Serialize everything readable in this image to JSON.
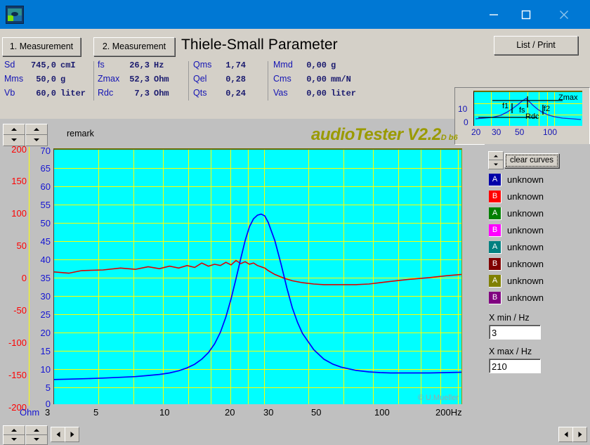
{
  "window": {
    "app_icon": "audiotester-app-icon",
    "minimize": "minimize-icon",
    "maximize": "maximize-icon",
    "close": "close-icon"
  },
  "toolbar": {
    "tab1_label": "1. Measurement",
    "tab2_label": "2. Measurement",
    "panel_title": "Thiele-Small Parameter",
    "list_print_label": "List / Print"
  },
  "parameters": {
    "group1": [
      {
        "name": "Sd",
        "value": "745,0",
        "unit": "cmI"
      },
      {
        "name": "Mms",
        "value": "50,0",
        "unit": "g"
      },
      {
        "name": "Vb",
        "value": "60,0",
        "unit": "liter"
      }
    ],
    "group2": [
      {
        "name": "fs",
        "value": "26,3",
        "unit": "Hz"
      },
      {
        "name": "Zmax",
        "value": "52,3",
        "unit": "Ohm"
      },
      {
        "name": "Rdc",
        "value": "7,3",
        "unit": "Ohm"
      }
    ],
    "group3": [
      {
        "name": "Qms",
        "value": "1,74",
        "unit": ""
      },
      {
        "name": "Qel",
        "value": "0,28",
        "unit": ""
      },
      {
        "name": "Qts",
        "value": "0,24",
        "unit": ""
      }
    ],
    "group4": [
      {
        "name": "Mmd",
        "value": "0,00",
        "unit": "g"
      },
      {
        "name": "Cms",
        "value": "0,00",
        "unit": "mm/N"
      },
      {
        "name": "Vas",
        "value": "0,00",
        "unit": "liter"
      }
    ]
  },
  "mini_chart": {
    "y_labels": [
      "10",
      "0"
    ],
    "x_labels": [
      "20",
      "30",
      "50",
      "100"
    ],
    "annotations": [
      "Zmax",
      "f1",
      "fs",
      "f2",
      "Rdc"
    ]
  },
  "remark": {
    "label": "remark",
    "spinner_left": "remark-spinner-left",
    "spinner_right": "remark-spinner-right"
  },
  "logo": {
    "text": "audioTester V2.2",
    "suffix": "D b6"
  },
  "chart_data": {
    "type": "line",
    "title": "",
    "xlabel": "Hz",
    "ylabel": "Ohm",
    "xscale": "log",
    "xlim": [
      3,
      210
    ],
    "x_ticks": [
      "3",
      "5",
      "10",
      "20",
      "30",
      "50",
      "100",
      "200Hz"
    ],
    "x_tick_values": [
      3,
      5,
      10,
      20,
      30,
      50,
      100,
      200
    ],
    "grid": true,
    "left_axis_phase": {
      "label": "",
      "color": "#ff0000",
      "ylim": [
        -200,
        200
      ],
      "ticks": [
        "200",
        "150",
        "100",
        "50",
        "0",
        "-50",
        "-100",
        "-150",
        "-200"
      ],
      "tick_values": [
        200,
        150,
        100,
        50,
        0,
        -50,
        -100,
        -150,
        -200
      ]
    },
    "left_axis_impedance": {
      "label": "Ohm",
      "color": "#1414d2",
      "ylim": [
        0,
        70
      ],
      "ticks": [
        "70",
        "65",
        "60",
        "55",
        "50",
        "45",
        "40",
        "35",
        "30",
        "25",
        "20",
        "15",
        "10",
        "5",
        "0"
      ],
      "tick_values": [
        70,
        65,
        60,
        55,
        50,
        45,
        40,
        35,
        30,
        25,
        20,
        15,
        10,
        5,
        0
      ]
    },
    "series": [
      {
        "name": "impedance",
        "color": "#0000ff",
        "axis": "impedance",
        "x": [
          3,
          3.5,
          4,
          4.5,
          5,
          6,
          7,
          8,
          9,
          10,
          11,
          12,
          13,
          14,
          15,
          16,
          17,
          18,
          19,
          20,
          21,
          22,
          23,
          24,
          25,
          26,
          27,
          28,
          30,
          32,
          34,
          36,
          38,
          40,
          45,
          50,
          55,
          60,
          70,
          80,
          90,
          100,
          120,
          150,
          180,
          210
        ],
        "y": [
          6.8,
          6.9,
          7.0,
          7.1,
          7.2,
          7.4,
          7.6,
          7.9,
          8.2,
          8.6,
          9.2,
          10.0,
          11.0,
          12.4,
          14.2,
          16.6,
          19.8,
          24.0,
          29.0,
          34.5,
          40.0,
          45.0,
          48.8,
          51.0,
          52.0,
          52.3,
          51.8,
          50.0,
          45.0,
          38.5,
          32.0,
          26.5,
          22.5,
          19.5,
          15.0,
          12.4,
          11.0,
          10.2,
          9.3,
          8.9,
          8.7,
          8.6,
          8.6,
          8.6,
          8.7,
          8.8
        ]
      },
      {
        "name": "phase",
        "color": "#dd0000",
        "axis": "phase",
        "x": [
          3,
          3.5,
          4,
          5,
          6,
          7,
          8,
          9,
          10,
          11,
          12,
          13,
          14,
          15,
          16,
          17,
          18,
          19,
          20,
          21,
          22,
          23,
          24,
          25,
          26,
          27,
          28,
          30,
          33,
          36,
          40,
          45,
          50,
          60,
          70,
          80,
          90,
          100,
          120,
          150,
          180,
          210
        ],
        "y": [
          8,
          6,
          10,
          11,
          14,
          12,
          16,
          13,
          17,
          14,
          18,
          15,
          22,
          17,
          20,
          18,
          23,
          19,
          26,
          21,
          24,
          20,
          22,
          18,
          16,
          14,
          10,
          4,
          -2,
          -6,
          -9,
          -11,
          -12,
          -12,
          -12,
          -11,
          -9,
          -7,
          -4,
          -1,
          2,
          4
        ]
      }
    ],
    "copyright": "© U.Mueller"
  },
  "curves": {
    "clear_button": "clear curves",
    "spinner": "curve-spinner",
    "items": [
      {
        "letter": "A",
        "color": "#0000a8",
        "label": "unknown"
      },
      {
        "letter": "B",
        "color": "#ff0000",
        "label": "unknown"
      },
      {
        "letter": "A",
        "color": "#008000",
        "label": "unknown"
      },
      {
        "letter": "B",
        "color": "#ff00ff",
        "label": "unknown"
      },
      {
        "letter": "A",
        "color": "#008080",
        "label": "unknown"
      },
      {
        "letter": "B",
        "color": "#800000",
        "label": "unknown"
      },
      {
        "letter": "A",
        "color": "#808000",
        "label": "unknown"
      },
      {
        "letter": "B",
        "color": "#800080",
        "label": "unknown"
      }
    ],
    "xmin_label": "X min / Hz",
    "xmin_value": "3",
    "xmax_label": "X max / Hz",
    "xmax_value": "210"
  },
  "bottom": {
    "scroll_left": "scroll-left-icon",
    "scroll_right": "scroll-right-icon"
  }
}
